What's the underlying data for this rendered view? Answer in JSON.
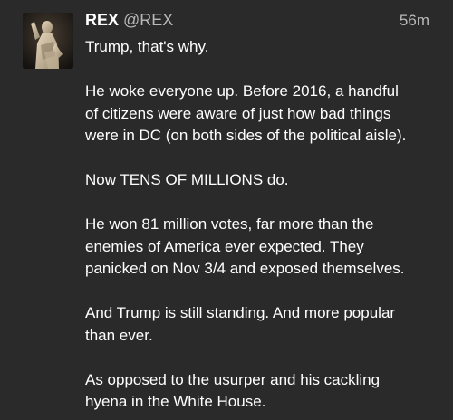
{
  "post": {
    "author": {
      "display_name": "REX",
      "handle": "@REX",
      "avatar_icon": "statue-avatar-icon"
    },
    "timestamp": "56m",
    "paragraphs": [
      [
        "Trump, that's why."
      ],
      [
        "He woke everyone up. Before 2016, a handful",
        "of citizens were aware of just how bad things",
        "were in DC (on both sides of the political aisle)."
      ],
      [
        "Now TENS OF MILLIONS do."
      ],
      [
        "He won 81 million votes, far more than the",
        "enemies of America ever expected. They",
        "panicked on Nov 3/4 and exposed themselves."
      ],
      [
        "And Trump is still standing. And more popular",
        "than ever."
      ],
      [
        "As opposed to the usurper and his cackling",
        "hyena in the White House."
      ]
    ]
  },
  "colors": {
    "background": "#2a2a2a",
    "text": "#ffffff",
    "muted": "#b9b9b9"
  }
}
